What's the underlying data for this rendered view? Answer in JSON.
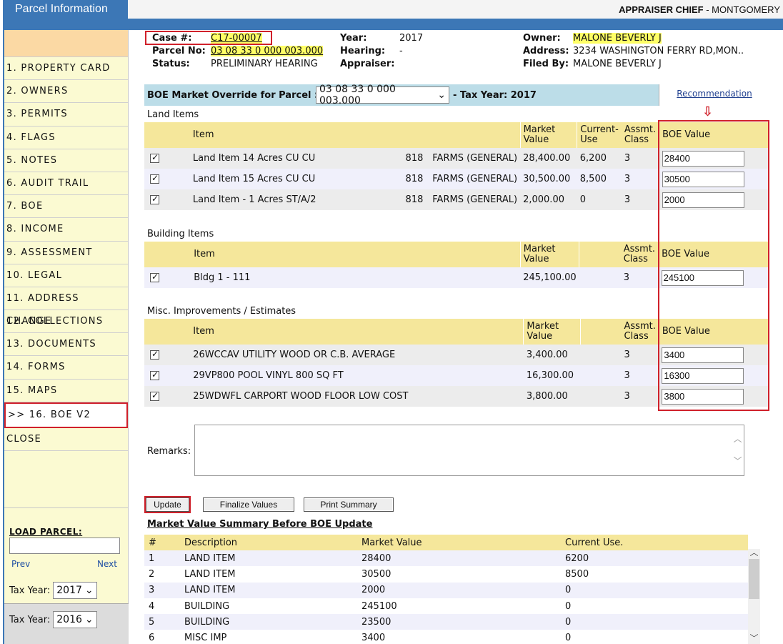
{
  "app": {
    "title": "Parcel Information",
    "user_role": "APPRAISER CHIEF",
    "user_sep": " - ",
    "user_county": "MONTGOMERY"
  },
  "sidebar": {
    "items": [
      {
        "label": "1. PROPERTY CARD"
      },
      {
        "label": "2. OWNERS"
      },
      {
        "label": "3. PERMITS"
      },
      {
        "label": "4. FLAGS"
      },
      {
        "label": "5. NOTES"
      },
      {
        "label": "6. AUDIT TRAIL"
      },
      {
        "label": "7. BOE"
      },
      {
        "label": "8. INCOME"
      },
      {
        "label": "9. ASSESSMENT"
      },
      {
        "label": "10. LEGAL"
      },
      {
        "label": "11. ADDRESS CHANGE"
      },
      {
        "label": "12. COLLECTIONS"
      },
      {
        "label": "13. DOCUMENTS"
      },
      {
        "label": "14. FORMS"
      },
      {
        "label": "15. MAPS"
      },
      {
        "label": ">> 16. BOE V2"
      },
      {
        "label": "CLOSE"
      }
    ],
    "load_parcel_label": "LOAD PARCEL:",
    "prev_label": "Prev",
    "next_label": "Next",
    "tax_year_label_1": "Tax Year:",
    "tax_year_value_1": "2017",
    "tax_year_label_2": "Tax Year:",
    "tax_year_value_2": "2016"
  },
  "header": {
    "case_label": "Case #:",
    "case_value": "C17-00007",
    "parcel_label": "Parcel No:",
    "parcel_value": "03 08 33 0 000 003.000",
    "status_label": "Status:",
    "status_value": "PRELIMINARY HEARING",
    "year_label": "Year:",
    "year_value": "2017",
    "hearing_label": "Hearing:",
    "hearing_value": "-",
    "appraiser_label": "Appraiser:",
    "appraiser_value": "",
    "owner_label": "Owner:",
    "owner_value": "MALONE BEVERLY J",
    "address_label": "Address:",
    "address_value": "3234 WASHINGTON FERRY RD,MON..",
    "filed_label": "Filed By:",
    "filed_value": "MALONE BEVERLY J"
  },
  "override": {
    "label": "BOE Market Override for Parcel :",
    "selected": "03 08 33 0 000 003.000",
    "tax_year": "- Tax Year: 2017",
    "recommendation": "Recommendation"
  },
  "land": {
    "title": "Land Items",
    "headers": {
      "item": "Item",
      "market": "Market Value",
      "current": "Current- Use",
      "class": "Assmt. Class",
      "boe": "BOE Value"
    },
    "rows": [
      {
        "item": "Land Item 14 Acres CU CU",
        "code": "818",
        "desc": "FARMS (GENERAL)",
        "market": "28,400.00",
        "current": "6,200",
        "class": "3",
        "boe": "28400"
      },
      {
        "item": "Land Item 15 Acres CU CU",
        "code": "818",
        "desc": "FARMS (GENERAL)",
        "market": "30,500.00",
        "current": "8,500",
        "class": "3",
        "boe": "30500"
      },
      {
        "item": "Land Item - 1 Acres ST/A/2",
        "code": "818",
        "desc": "FARMS (GENERAL)",
        "market": "2,000.00",
        "current": "0",
        "class": "3",
        "boe": "2000"
      }
    ]
  },
  "building": {
    "title": "Building Items",
    "headers": {
      "item": "Item",
      "market": "Market Value",
      "class": "Assmt. Class",
      "boe": "BOE Value"
    },
    "rows": [
      {
        "item": "Bldg 1 - 111",
        "market": "245,100.00",
        "class": "3",
        "boe": "245100"
      }
    ]
  },
  "misc": {
    "title": "Misc. Improvements / Estimates",
    "headers": {
      "item": "Item",
      "market": "Market Value",
      "class": "Assmt. Class",
      "boe": "BOE Value"
    },
    "rows": [
      {
        "item": "26WCCAV UTILITY WOOD OR C.B. AVERAGE",
        "market": "3,400.00",
        "class": "3",
        "boe": "3400"
      },
      {
        "item": "29VP800 POOL VINYL 800 SQ FT",
        "market": "16,300.00",
        "class": "3",
        "boe": "16300"
      },
      {
        "item": "25WDWFL CARPORT WOOD FLOOR LOW COST",
        "market": "3,800.00",
        "class": "3",
        "boe": "3800"
      }
    ]
  },
  "remarks_label": "Remarks:",
  "buttons": {
    "update": "Update",
    "finalize": "Finalize Values",
    "print": "Print Summary"
  },
  "summary": {
    "title": "Market Value Summary Before BOE Update",
    "headers": {
      "num": "#",
      "desc": "Description",
      "market": "Market Value",
      "current": "Current Use."
    },
    "rows": [
      {
        "num": "1",
        "desc": "LAND ITEM",
        "market": "28400",
        "current": "6200"
      },
      {
        "num": "2",
        "desc": "LAND ITEM",
        "market": "30500",
        "current": "8500"
      },
      {
        "num": "3",
        "desc": "LAND ITEM",
        "market": "2000",
        "current": "0"
      },
      {
        "num": "4",
        "desc": "BUILDING",
        "market": "245100",
        "current": "0"
      },
      {
        "num": "5",
        "desc": "BUILDING",
        "market": "23500",
        "current": "0"
      },
      {
        "num": "6",
        "desc": "MISC IMP",
        "market": "3400",
        "current": "0"
      }
    ]
  },
  "icons": {
    "dropdown": "chevron-down-icon",
    "arrow": "arrow-down-icon"
  },
  "colors": {
    "accent": "#3c77b6",
    "highlight": "#ffff66",
    "header_row": "#f5e79b",
    "red_outline": "#d0202a"
  }
}
